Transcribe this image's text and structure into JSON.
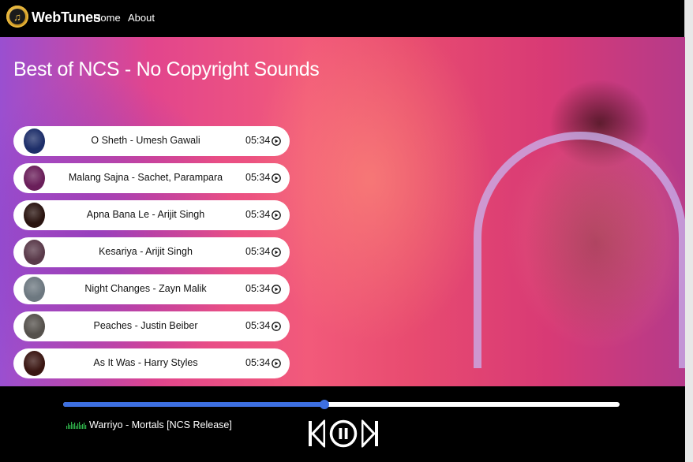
{
  "navbar": {
    "brand": "WebTunes",
    "links": [
      "Home",
      "About"
    ]
  },
  "hero": {
    "title": "Best of NCS - No Copyright Sounds"
  },
  "songs": [
    {
      "title": "O Sheth - Umesh Gawali",
      "duration": "05:34",
      "thumb_color": "#1e2f6a"
    },
    {
      "title": "Malang Sajna - Sachet, Parampara",
      "duration": "05:34",
      "thumb_color": "#6a1f5a"
    },
    {
      "title": "Apna Bana Le - Arijit Singh",
      "duration": "05:34",
      "thumb_color": "#2a1410"
    },
    {
      "title": "Kesariya - Arijit Singh",
      "duration": "05:34",
      "thumb_color": "#5a3a4a"
    },
    {
      "title": "Night Changes - Zayn Malik",
      "duration": "05:34",
      "thumb_color": "#6d7880"
    },
    {
      "title": "Peaches - Justin Beiber",
      "duration": "05:34",
      "thumb_color": "#55514c"
    },
    {
      "title": "As It Was - Harry Styles",
      "duration": "05:34",
      "thumb_color": "#3a1612"
    }
  ],
  "player": {
    "now_playing": "Warriyo - Mortals [NCS Release]",
    "progress": 0.47,
    "accent": "#3d6fe0",
    "eq_color": "#2fb14a"
  },
  "icons": {
    "logo": "music-note-icon",
    "song_play": "play-circle-icon",
    "prev": "skip-previous-icon",
    "pause": "pause-circle-icon",
    "next": "skip-next-icon",
    "now_playing": "equalizer-icon"
  }
}
